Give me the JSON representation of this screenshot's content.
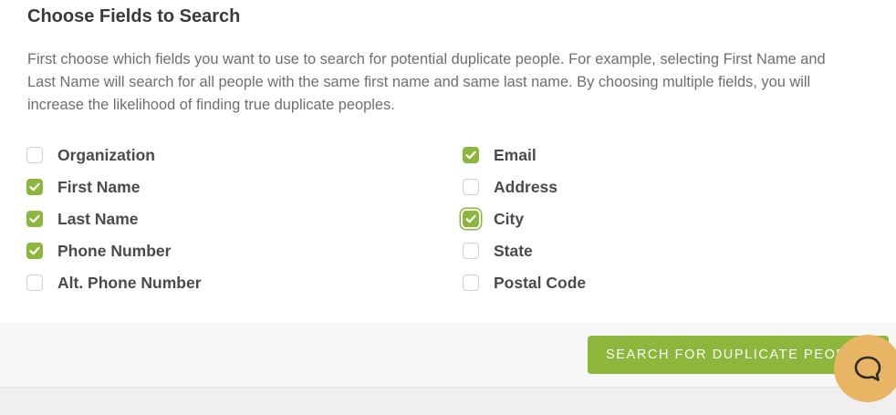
{
  "section": {
    "title": "Choose Fields to Search",
    "description": "First choose which fields you want to use to search for potential duplicate people. For example, selecting First Name and Last Name will search for all people with the same first name and same last name. By choosing multiple fields, you will increase the likelihood of finding true duplicate peoples."
  },
  "fields": {
    "left": [
      {
        "label": "Organization",
        "checked": false
      },
      {
        "label": "First Name",
        "checked": true
      },
      {
        "label": "Last Name",
        "checked": true
      },
      {
        "label": "Phone Number",
        "checked": true
      },
      {
        "label": "Alt. Phone Number",
        "checked": false
      }
    ],
    "right": [
      {
        "label": "Email",
        "checked": true
      },
      {
        "label": "Address",
        "checked": false
      },
      {
        "label": "City",
        "checked": true,
        "focused": true
      },
      {
        "label": "State",
        "checked": false
      },
      {
        "label": "Postal Code",
        "checked": false
      }
    ]
  },
  "footer": {
    "search_button_label": "SEARCH FOR DUPLICATE PEOPLE"
  },
  "colors": {
    "accent": "#8cb63c",
    "chat_bubble": "#e8b565"
  },
  "icons": {
    "checkmark": "check-icon",
    "chat": "chat-bubble-icon"
  }
}
